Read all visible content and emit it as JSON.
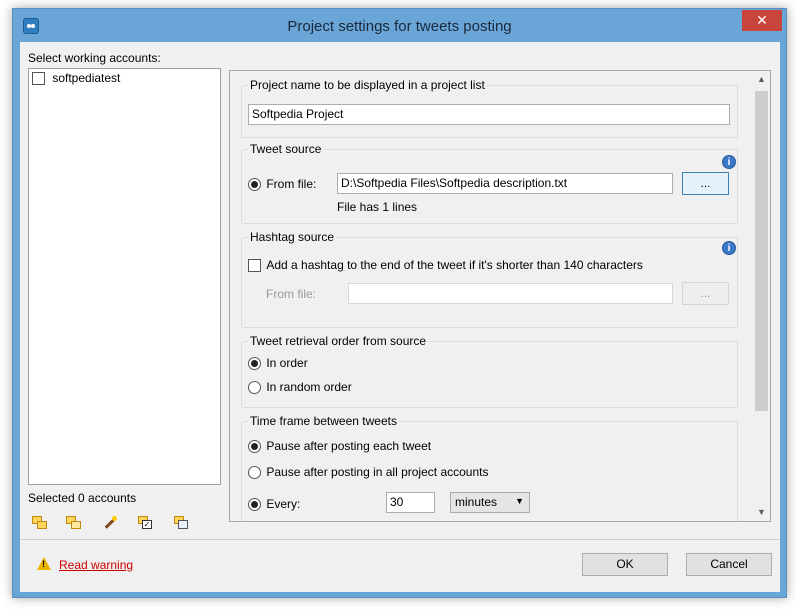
{
  "window": {
    "title": "Project settings for tweets posting",
    "close_symbol": "✕"
  },
  "accounts": {
    "label": "Select working accounts:",
    "items": [
      {
        "name": "softpediatest",
        "checked": false
      }
    ],
    "selected_text": "Selected 0 accounts",
    "tools": [
      "add-account-icon",
      "copy-account-icon",
      "wand-icon",
      "check-all-icon",
      "uncheck-all-icon"
    ]
  },
  "project_name": {
    "title": "Project name to be displayed in a project list",
    "value": "Softpedia Project"
  },
  "tweet_source": {
    "title": "Tweet source",
    "from_file_label": "From file:",
    "file_path": "D:\\Softpedia Files\\Softpedia description.txt",
    "browse_label": "...",
    "file_info": "File has 1 lines",
    "info_glyph": "i"
  },
  "hashtag_source": {
    "title": "Hashtag source",
    "checkbox_label": "Add a hashtag to the end of the tweet if it's shorter than 140 characters",
    "from_file_label": "From file:",
    "file_path": "",
    "browse_label": "...",
    "info_glyph": "i"
  },
  "retrieval_order": {
    "title": "Tweet retrieval order from source",
    "options": [
      "In order",
      "In random order"
    ],
    "selected": 0
  },
  "time_frame": {
    "title": "Time frame between tweets",
    "options": [
      "Pause after posting each tweet",
      "Pause after posting in all project accounts",
      "Every:"
    ],
    "selected_pause": 0,
    "every_value": "30",
    "every_unit": "minutes"
  },
  "footer": {
    "warning_link": "Read warning",
    "ok_label": "OK",
    "cancel_label": "Cancel"
  },
  "colors": {
    "title_bar": "#6aa5d8",
    "close_button": "#c7453a",
    "link": "#cc0000"
  }
}
